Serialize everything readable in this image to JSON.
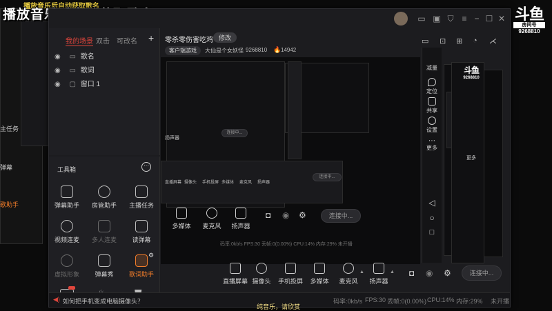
{
  "overlay": {
    "banner_title": "播放音乐后自动获取歌名",
    "banner_ghost": "播放音乐后自动获取歌名",
    "logo_brand": "斗鱼",
    "logo_sub": "房间号",
    "room_number": "9268810",
    "now_playing": "纯音乐，请欣赏"
  },
  "scenes": {
    "tab_active": "我的场景",
    "tab_dual": "双击",
    "tab_rename": "可改名",
    "add": "+",
    "items": [
      {
        "label": "歌名"
      },
      {
        "label": "歌词"
      },
      {
        "label": "窗口 1"
      }
    ]
  },
  "stream": {
    "title": "零杀零伤害吃鸡",
    "edit_button": "修改",
    "category": "客户端游戏",
    "streamer": "大仙是个女妖怪",
    "room_id": "9268810",
    "heat": "14942"
  },
  "toolbox": {
    "title": "工具箱",
    "tools": [
      {
        "label": "弹幕助手"
      },
      {
        "label": "房管助手"
      },
      {
        "label": "主播任务"
      },
      {
        "label": "视频连麦"
      },
      {
        "label": "多人连麦"
      },
      {
        "label": "读弹幕"
      },
      {
        "label": "虚拟形象"
      },
      {
        "label": "弹幕秀"
      },
      {
        "label": "歌词助手"
      }
    ]
  },
  "right_panel": {
    "items": [
      {
        "label": "减量"
      },
      {
        "label": "定位"
      },
      {
        "label": "共享"
      },
      {
        "label": "设置"
      },
      {
        "label": "更多"
      }
    ]
  },
  "controls": {
    "items": [
      {
        "label": "直播屏幕"
      },
      {
        "label": "摄像头"
      },
      {
        "label": "手机投屏"
      },
      {
        "label": "多媒体"
      },
      {
        "label": "麦克风"
      },
      {
        "label": "扬声器"
      }
    ],
    "connect_button": "连接中..."
  },
  "status": {
    "help_link": "如何把手机变成电脑摄像头？",
    "bitrate": "码率:0kb/s",
    "fps": "FPS:30",
    "drop": "丢帧:0(0.00%)",
    "cpu": "CPU:14%",
    "memory": "内存:29%",
    "state": "未开播"
  },
  "mirror": {
    "left_label_task": "主任务",
    "left_label_danmu": "弹幕",
    "left_label_music": "歌助手",
    "mid_multimedia": "多媒体",
    "mid_mic": "麦克风",
    "mid_speaker": "扬声器",
    "mid_connect": "连接中...",
    "mid_status": "码率:0kb/s   FPS:30   丢帧:0(0.00%)   CPU:14%   内存:29%   未开播",
    "inner_speaker": "扬声器",
    "inner_connect": "连接中...",
    "inner_row": [
      "直播屏幕",
      "摄像头",
      "手机投屏",
      "多媒体",
      "麦克风",
      "扬声器"
    ],
    "far_right_more": "更多",
    "far_right_logo_num": "9268810"
  },
  "colors": {
    "accent": "#f07c2a",
    "brand_red": "#e2463c",
    "banner_yellow": "#f2d544",
    "bg_window": "#1c1c1f"
  }
}
